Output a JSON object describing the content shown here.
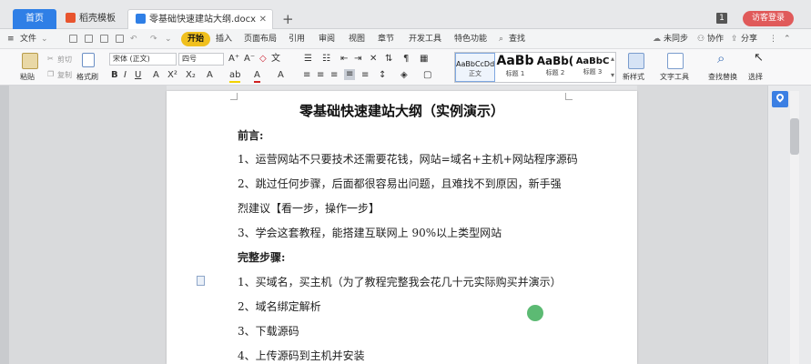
{
  "tabs": {
    "home": "首页",
    "template": "稻壳模板",
    "document": "零基础快速建站大纲.docx",
    "add": "+"
  },
  "window": {
    "badge": "1",
    "login": "访客登录"
  },
  "menu": {
    "file": "文件",
    "start": "开始",
    "insert": "插入",
    "layout": "页面布局",
    "reference": "引用",
    "review": "审阅",
    "view": "视图",
    "chapter": "章节",
    "dev": "开发工具",
    "feature": "特色功能",
    "search": "查找",
    "unsync": "未同步",
    "collab": "协作",
    "share": "分享"
  },
  "ribbon": {
    "paste": "粘贴",
    "cut": "剪切",
    "copy": "复制",
    "format_painter": "格式刷",
    "font_name": "宋体 (正文)",
    "font_size": "四号",
    "new_style": "新样式",
    "text_tools": "文字工具",
    "find_replace": "查找替换",
    "select": "选择",
    "styles": [
      {
        "sample": "AaBbCcDd",
        "name": "正文"
      },
      {
        "sample": "AaBb",
        "name": "标题 1"
      },
      {
        "sample": "AaBb(",
        "name": "标题 2"
      },
      {
        "sample": "AaBbC",
        "name": "标题 3"
      }
    ]
  },
  "document": {
    "title": "零基础快速建站大纲（实例演示）",
    "lines": [
      "前言:",
      "1、运营网站不只要技术还需要花钱，网站=域名+主机+网站程序源码",
      "2、跳过任何步骤，后面都很容易出问题，且难找不到原因，新手强",
      "烈建议【看一步，操作一步】",
      "3、学会这套教程，能搭建互联网上 90%以上类型网站",
      "完整步骤:",
      "1、买域名，买主机（为了教程完整我会花几十元实际购买并演示）",
      "2、域名绑定解析",
      "3、下载源码",
      "4、上传源码到主机并安装"
    ]
  },
  "colors": {
    "accent_blue": "#2f7fe6",
    "start_yellow": "#f0c01e",
    "login_red": "#e05a5a"
  }
}
